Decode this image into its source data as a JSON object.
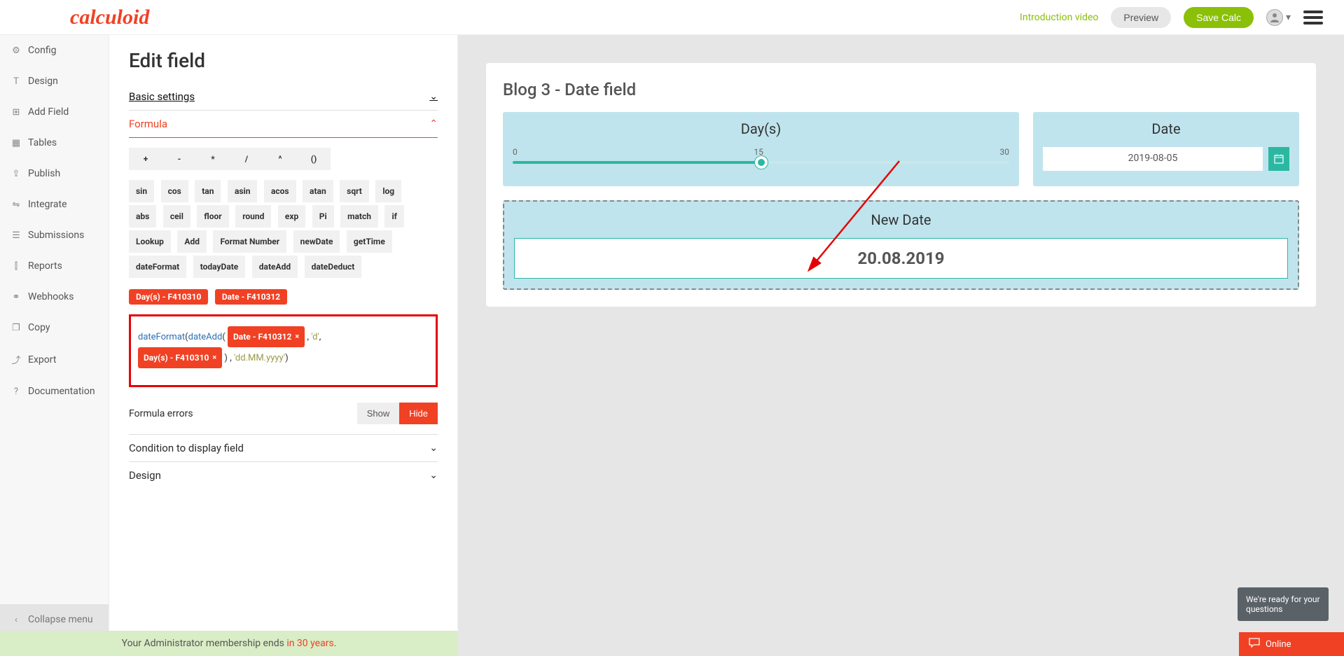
{
  "header": {
    "logo": "calculoid",
    "intro": "Introduction video",
    "preview": "Preview",
    "save": "Save Calc"
  },
  "sidebar": {
    "items": [
      {
        "icon": "⚙",
        "label": "Config"
      },
      {
        "icon": "T",
        "label": "Design"
      },
      {
        "icon": "⊞",
        "label": "Add Field"
      },
      {
        "icon": "▦",
        "label": "Tables"
      },
      {
        "icon": "⇪",
        "label": "Publish"
      },
      {
        "icon": "⇋",
        "label": "Integrate"
      },
      {
        "icon": "☰",
        "label": "Submissions"
      },
      {
        "icon": "⫿",
        "label": "Reports"
      },
      {
        "icon": "⚭",
        "label": "Webhooks"
      },
      {
        "icon": "❐",
        "label": "Copy"
      },
      {
        "icon": "⤴",
        "label": "Export"
      },
      {
        "icon": "?",
        "label": "Documentation"
      }
    ],
    "collapse": "Collapse menu"
  },
  "edit": {
    "title": "Edit field",
    "basic": "Basic settings",
    "formula": "Formula",
    "ops": [
      "+",
      "-",
      "*",
      "/",
      "^",
      "()"
    ],
    "fns": [
      "sin",
      "cos",
      "tan",
      "asin",
      "acos",
      "atan",
      "sqrt",
      "log",
      "abs",
      "ceil",
      "floor",
      "round",
      "exp",
      "Pi",
      "match",
      "if",
      "Lookup",
      "Add",
      "Format Number",
      "newDate",
      "getTime",
      "dateFormat",
      "todayDate",
      "dateAdd",
      "dateDeduct"
    ],
    "field_tags": [
      "Day(s) - F410310",
      "Date - F410312"
    ],
    "expr": {
      "f1": "dateFormat",
      "p1": "(",
      "f2": "dateAdd",
      "p2": "(",
      "tag1": "Date - F410312",
      "c1": ",",
      "s1": "'d'",
      "c2": ",",
      "tag2": "Day(s) - F410310",
      "p3": ")",
      "c3": ",",
      "s2": "'dd.MM.yyyy'",
      "p4": ")"
    },
    "errors_label": "Formula errors",
    "show": "Show",
    "hide": "Hide",
    "condition": "Condition to display field",
    "design": "Design"
  },
  "preview": {
    "title": "Blog 3 - Date field",
    "days_label": "Day(s)",
    "slider_min": "0",
    "slider_mid": "15",
    "slider_max": "30",
    "date_label": "Date",
    "date_value": "2019-08-05",
    "newdate_label": "New Date",
    "newdate_value": "20.08.2019"
  },
  "footer": {
    "text": "Your Administrator membership ends ",
    "hl": "in 30 years",
    "dot": "."
  },
  "chat": {
    "pop": "We're ready for your questions",
    "status": "Online"
  }
}
